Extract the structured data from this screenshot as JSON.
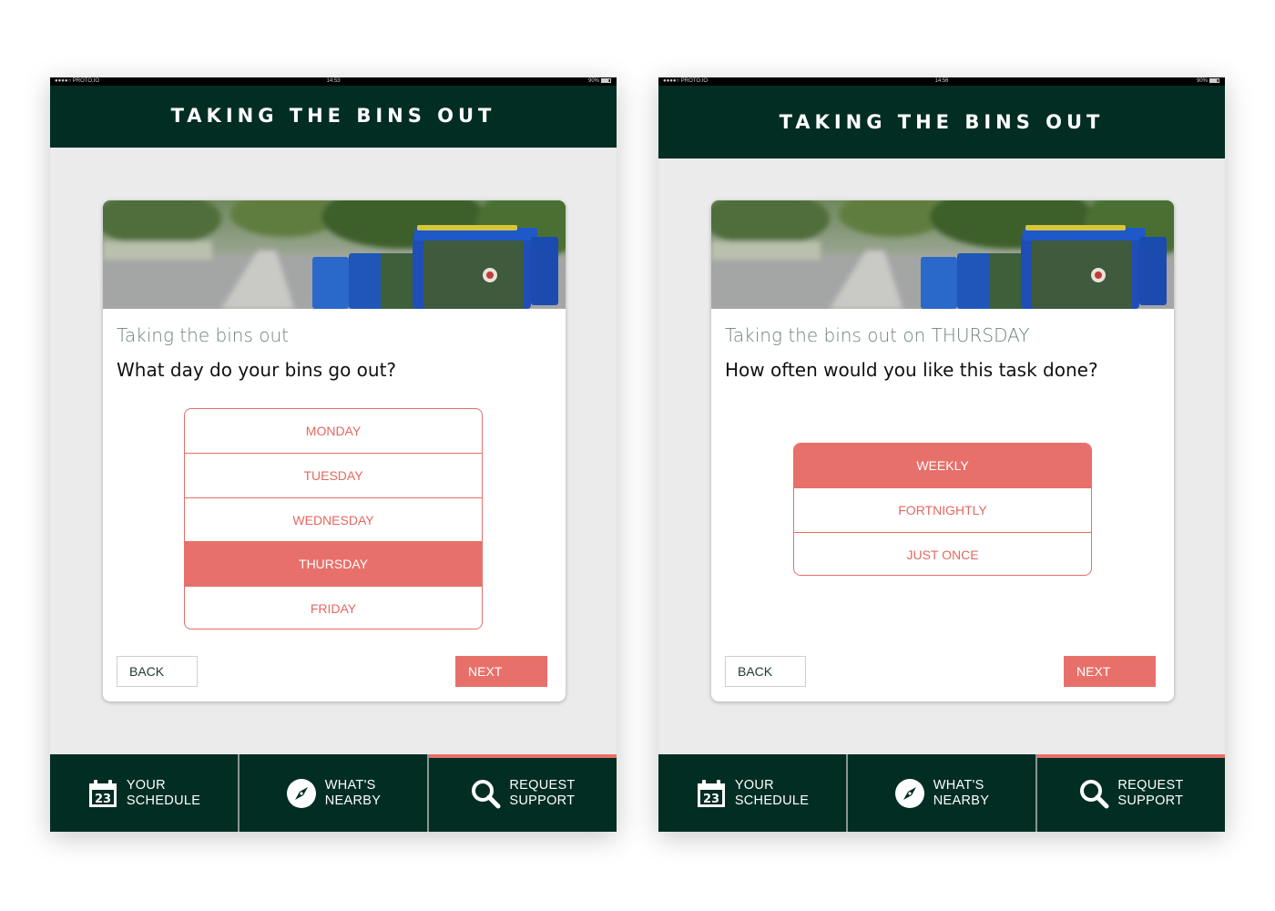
{
  "screens": [
    {
      "status": {
        "carrier": "●●●●○ PROTO.IO",
        "time": "14:53",
        "battery": "90%"
      },
      "header_title": "TAKING THE BINS OUT",
      "card": {
        "subtitle": "Taking the bins out",
        "question": "What day do your bins go out?",
        "options": [
          {
            "label": "MONDAY",
            "selected": false
          },
          {
            "label": "TUESDAY",
            "selected": false
          },
          {
            "label": "WEDNESDAY",
            "selected": false
          },
          {
            "label": "THURSDAY",
            "selected": true
          },
          {
            "label": "FRIDAY",
            "selected": false
          }
        ],
        "back_label": "BACK",
        "next_label": "NEXT"
      }
    },
    {
      "status": {
        "carrier": "●●●●○ PROTO.IO",
        "time": "14:56",
        "battery": "90%"
      },
      "header_title": "TAKING THE BINS OUT",
      "card": {
        "subtitle": "Taking the bins out on THURSDAY",
        "question": "How often would you like this task done?",
        "options": [
          {
            "label": "WEEKLY",
            "selected": true
          },
          {
            "label": "FORTNIGHTLY",
            "selected": false
          },
          {
            "label": "JUST ONCE",
            "selected": false
          }
        ],
        "back_label": "BACK",
        "next_label": "NEXT"
      }
    }
  ],
  "tabbar": {
    "tabs": [
      {
        "line1": "YOUR",
        "line2": "SCHEDULE",
        "icon": "calendar-icon",
        "calendar_day": "23",
        "active": false
      },
      {
        "line1": "WHAT'S",
        "line2": "NEARBY",
        "icon": "compass-icon",
        "active": false
      },
      {
        "line1": "REQUEST",
        "line2": "SUPPORT",
        "icon": "search-icon",
        "active": true
      }
    ]
  },
  "colors": {
    "header_bg": "#022d23",
    "accent": "#e8706a",
    "screen_bg": "#ebebeb"
  }
}
